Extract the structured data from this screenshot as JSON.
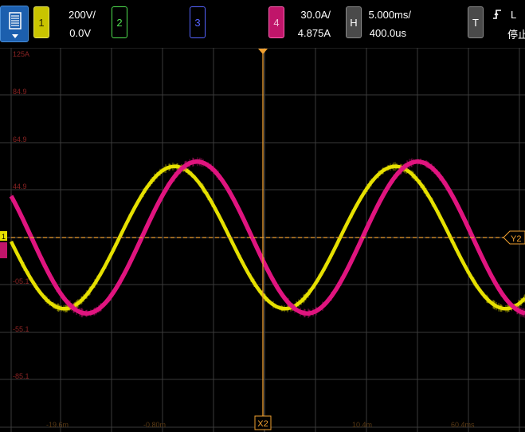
{
  "channels": {
    "ch1": {
      "label": "1",
      "scale": "200V/",
      "offset": "0.0V",
      "color": "#e6e000"
    },
    "ch2": {
      "label": "2",
      "color": "#4fe04f"
    },
    "ch3": {
      "label": "3",
      "color": "#5563ff"
    },
    "ch4": {
      "label": "4",
      "scale": "30.0A/",
      "offset": "4.875A",
      "color": "#e0147f"
    }
  },
  "horizontal": {
    "label": "H",
    "timebase": "5.000ms/",
    "delay": "400.0us"
  },
  "trigger": {
    "label": "T",
    "edge_icon": "rising-edge-icon",
    "level_partial": "L",
    "status": "停止"
  },
  "menu": {
    "icon": "menu-icon"
  },
  "plot": {
    "y_labels": [
      "125A",
      "84.9",
      "64.9",
      "44.9",
      "-05.1",
      "-55.1",
      "-85.1"
    ],
    "x_labels": [
      "-19.6m",
      "-0.80m",
      "10.4m",
      "60.4ms"
    ],
    "cursor_x_label": "X2",
    "cursor_y_label": "Y2",
    "marker_left": "1"
  },
  "chart_data": {
    "type": "line",
    "series": [
      {
        "name": "1",
        "shape": "sine",
        "periods_visible": 2.3,
        "amplitude_divisions": 1.5,
        "color": "#e6e000"
      },
      {
        "name": "4",
        "shape": "sine",
        "periods_visible": 2.3,
        "amplitude_divisions": 1.6,
        "color": "#e0147f"
      }
    ],
    "grid": true,
    "divisions_x": 10,
    "divisions_y": 8
  }
}
